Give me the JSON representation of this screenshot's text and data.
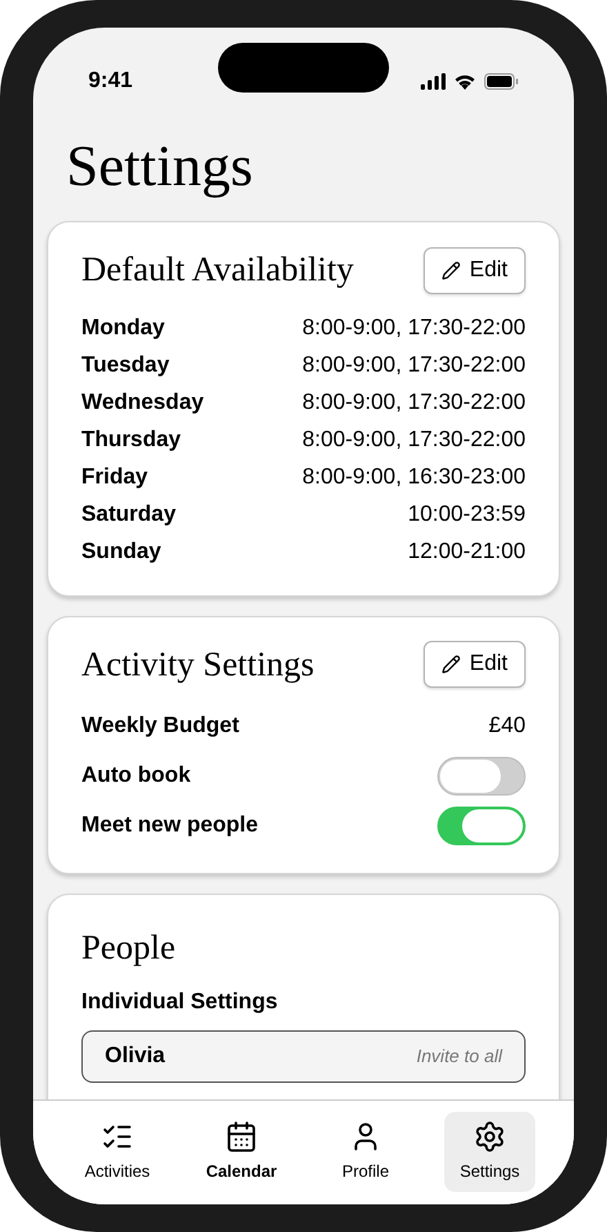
{
  "status_bar": {
    "time": "9:41"
  },
  "title": "Settings",
  "availability": {
    "title": "Default Availability",
    "edit_label": "Edit",
    "days": [
      {
        "day": "Monday",
        "hours": "8:00-9:00, 17:30-22:00"
      },
      {
        "day": "Tuesday",
        "hours": "8:00-9:00, 17:30-22:00"
      },
      {
        "day": "Wednesday",
        "hours": "8:00-9:00, 17:30-22:00"
      },
      {
        "day": "Thursday",
        "hours": "8:00-9:00, 17:30-22:00"
      },
      {
        "day": "Friday",
        "hours": "8:00-9:00, 16:30-23:00"
      },
      {
        "day": "Saturday",
        "hours": "10:00-23:59"
      },
      {
        "day": "Sunday",
        "hours": "12:00-21:00"
      }
    ]
  },
  "activity_settings": {
    "title": "Activity Settings",
    "edit_label": "Edit",
    "rows": [
      {
        "kind": "value",
        "label": "Weekly Budget",
        "value": "£40"
      },
      {
        "kind": "toggle",
        "label": "Auto book",
        "on": false
      },
      {
        "kind": "toggle",
        "label": "Meet new people",
        "on": true
      }
    ]
  },
  "people": {
    "title": "People",
    "subtitle": "Individual Settings",
    "items": [
      {
        "name": "Olivia",
        "setting": "Invite to all"
      }
    ]
  },
  "tab_bar": [
    {
      "label": "Activities",
      "selected": false,
      "bold": false
    },
    {
      "label": "Calendar",
      "selected": false,
      "bold": true
    },
    {
      "label": "Profile",
      "selected": false,
      "bold": false
    },
    {
      "label": "Settings",
      "selected": true,
      "bold": false
    }
  ]
}
